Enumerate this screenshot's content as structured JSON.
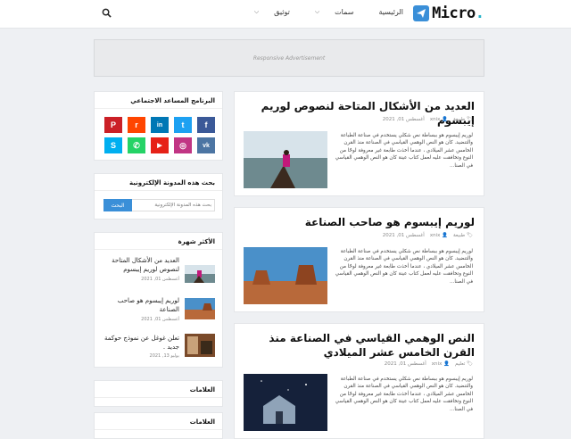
{
  "header": {
    "logo_text": "Micro",
    "logo_dot": ".",
    "nav": [
      {
        "label": "الرئيسية",
        "has_chevron": false
      },
      {
        "label": "سمات",
        "has_chevron": true
      },
      {
        "label": "توثيق",
        "has_chevron": true
      }
    ]
  },
  "ad": {
    "label": "Responsive Advertisement"
  },
  "posts": [
    {
      "title": "العديد من الأشكال المتاحة لنصوص لوريم إيبسوم",
      "category": "طبيعة",
      "author": "xnix",
      "date": "أغسطس 01, 2021",
      "excerpt": "لوريم إيبسوم هو ببساطة نص شكلي يستخدم في صناعة الطباعة والتنضيد. كان  هو النص الوهمي القياسي في الصناعة منذ القرن الخامس عشر الميلادي ، عندما أخذت طابعة غير معروفة لوحًا من النوع وتخافقت عليه لعمل كتاب عينة كان  هو النص الوهمي القياسي في الصنا..."
    },
    {
      "title": "لوريم إيبسوم هو صاحب الصناعة",
      "category": "طبيعة",
      "author": "xnix",
      "date": "أغسطس 01, 2021",
      "excerpt": "لوريم إيبسوم هو ببساطة نص شكلي يستخدم في صناعة الطباعة والتنضيد. كان  هو النص الوهمي القياسي في الصناعة منذ القرن الخامس عشر الميلادي ، عندما أخذت طابعة غير معروفة لوحًا من النوع وتخافقت عليه لعمل كتاب عينة كان  هو النص الوهمي القياسي في الصنا..."
    },
    {
      "title": "النص الوهمي القياسي في الصناعة منذ القرن الخامس عشر الميلادي",
      "category": "تعليم",
      "author": "xnix",
      "date": "أغسطس 01, 2021",
      "excerpt": "لوريم إيبسوم هو ببساطة نص شكلي يستخدم في صناعة الطباعة والتنضيد. كان  هو النص الوهمي القياسي في الصناعة منذ القرن الخامس عشر الميلادي ، عندما أخذت طابعة غير معروفة لوحًا من النوع وتخافقت عليه لعمل كتاب عينة كان  هو النص الوهمي القياسي في الصنا..."
    }
  ],
  "sidebar": {
    "social": {
      "title": "البرنامج المساعد الاجتماعي",
      "icons": [
        {
          "name": "facebook",
          "glyph": "f",
          "color": "#3b5998"
        },
        {
          "name": "twitter",
          "glyph": "t",
          "color": "#1da1f2"
        },
        {
          "name": "linkedin",
          "glyph": "in",
          "color": "#0077b5"
        },
        {
          "name": "reddit",
          "glyph": "r",
          "color": "#ff4500"
        },
        {
          "name": "pinterest",
          "glyph": "P",
          "color": "#cb2027"
        },
        {
          "name": "vk",
          "glyph": "vk",
          "color": "#4c75a3"
        },
        {
          "name": "instagram",
          "glyph": "◎",
          "color": "#c13584"
        },
        {
          "name": "youtube",
          "glyph": "▶",
          "color": "#e62117"
        },
        {
          "name": "whatsapp",
          "glyph": "✆",
          "color": "#25d366"
        },
        {
          "name": "skype",
          "glyph": "S",
          "color": "#00aff0"
        }
      ]
    },
    "search": {
      "title": "بحث هذه المدونة الإلكترونية",
      "placeholder": "بحث هذه المدونة الإلكترونية",
      "button": "البحث"
    },
    "popular": {
      "title": "الأكثر شهرة",
      "items": [
        {
          "title": "العديد من الأشكال المتاحة لنصوص لوريم إيبسوم",
          "date": "أغسطس 01, 2021"
        },
        {
          "title": "لوريم إيبسوم هو صاحب الصناعة",
          "date": "أغسطس 01, 2021"
        },
        {
          "title": "تعلن غوغل عن نموذج حوكمة جديد .",
          "date": "يوليو 13, 2021"
        }
      ]
    },
    "labels1": {
      "title": "العلامات"
    },
    "labels2": {
      "title": "العلامات"
    }
  },
  "colors": {
    "accent": "#3a8fd8",
    "brand_dot": "#27b2c9"
  }
}
